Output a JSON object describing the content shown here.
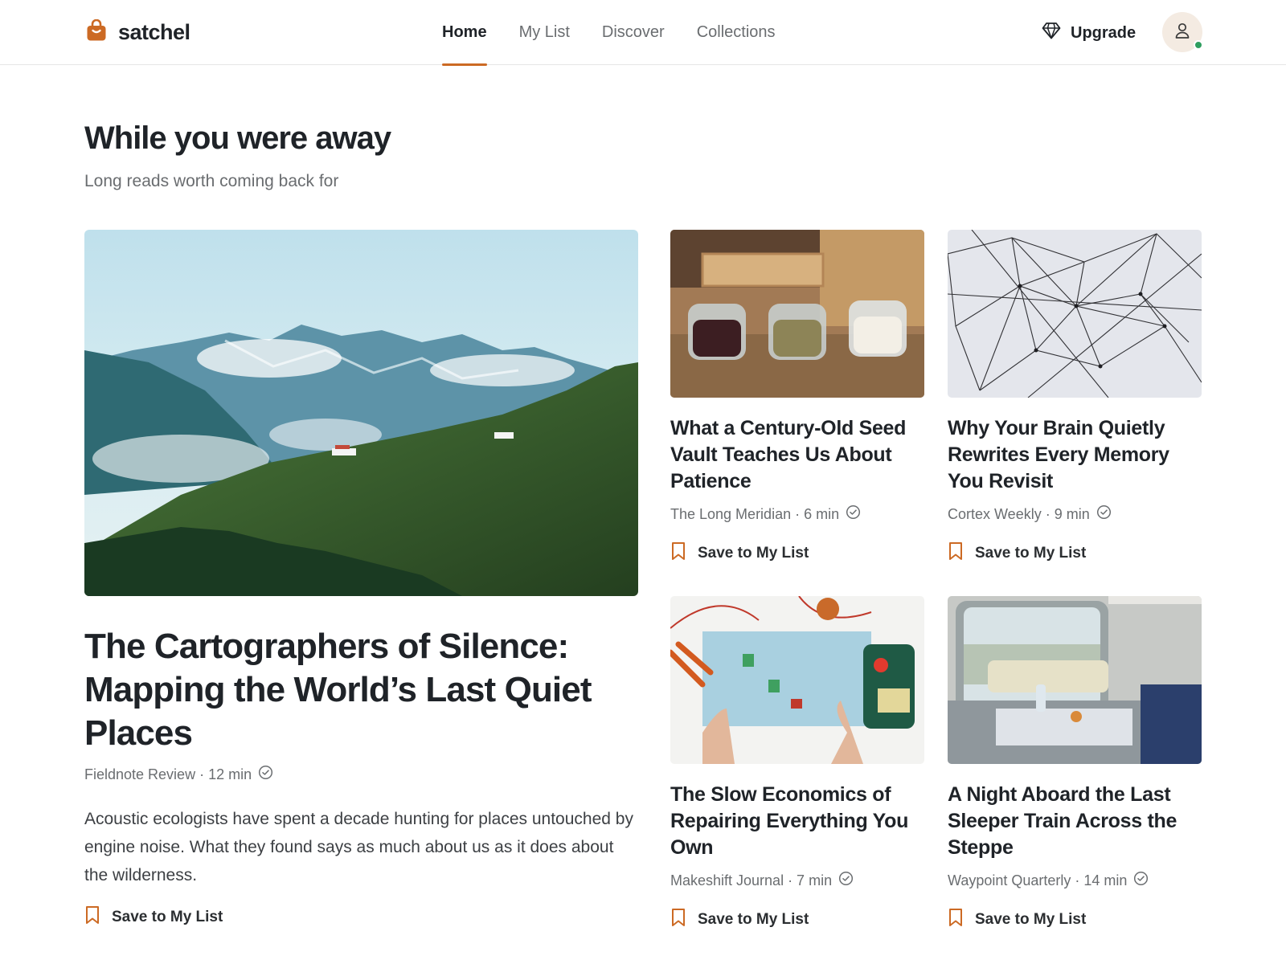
{
  "header": {
    "brand": "satchel",
    "tabs": [
      {
        "label": "Home",
        "active": true
      },
      {
        "label": "My List",
        "active": false
      },
      {
        "label": "Discover",
        "active": false
      },
      {
        "label": "Collections",
        "active": false
      }
    ],
    "upgrade_label": "Upgrade",
    "icons": {
      "brand": "bag-icon",
      "upgrade": "diamond-icon",
      "avatar": "user-icon"
    }
  },
  "section": {
    "title": "While you were away",
    "subtitle": "Long reads worth coming back for"
  },
  "featured": {
    "title": "The Cartographers of Silence: Mapping the World’s Last Quiet Places",
    "source": "Fieldnote Review · 12 min",
    "excerpt": "Acoustic ecologists have spent a decade hunting for places untouched by engine noise. What they found says as much about us as it does about the wilderness.",
    "save_label": "Save to My List",
    "image": "misty-mountain-photo"
  },
  "cards": [
    {
      "title": "What a Century-Old Seed Vault Teaches Us About Patience",
      "source": "The Long Meridian · 6 min",
      "save_label": "Save to My List",
      "image": "seed-jars-photo"
    },
    {
      "title": "Why Your Brain Quietly Rewrites Every Memory You Revisit",
      "source": "Cortex Weekly · 9 min",
      "save_label": "Save to My List",
      "image": "string-network-photo"
    },
    {
      "title": "The Slow Economics of Repairing Everything You Own",
      "source": "Makeshift Journal · 7 min",
      "save_label": "Save to My List",
      "image": "soldering-desk-photo"
    },
    {
      "title": "A Night Aboard the Last Sleeper Train Across the Steppe",
      "source": "Waypoint Quarterly · 14 min",
      "save_label": "Save to My List",
      "image": "train-cabin-photo"
    }
  ],
  "colors": {
    "accent": "#cc6a24",
    "text": "#1f2328",
    "muted": "#6a6d70",
    "divider": "#e6e6e6",
    "presence": "#2f9e5f"
  }
}
